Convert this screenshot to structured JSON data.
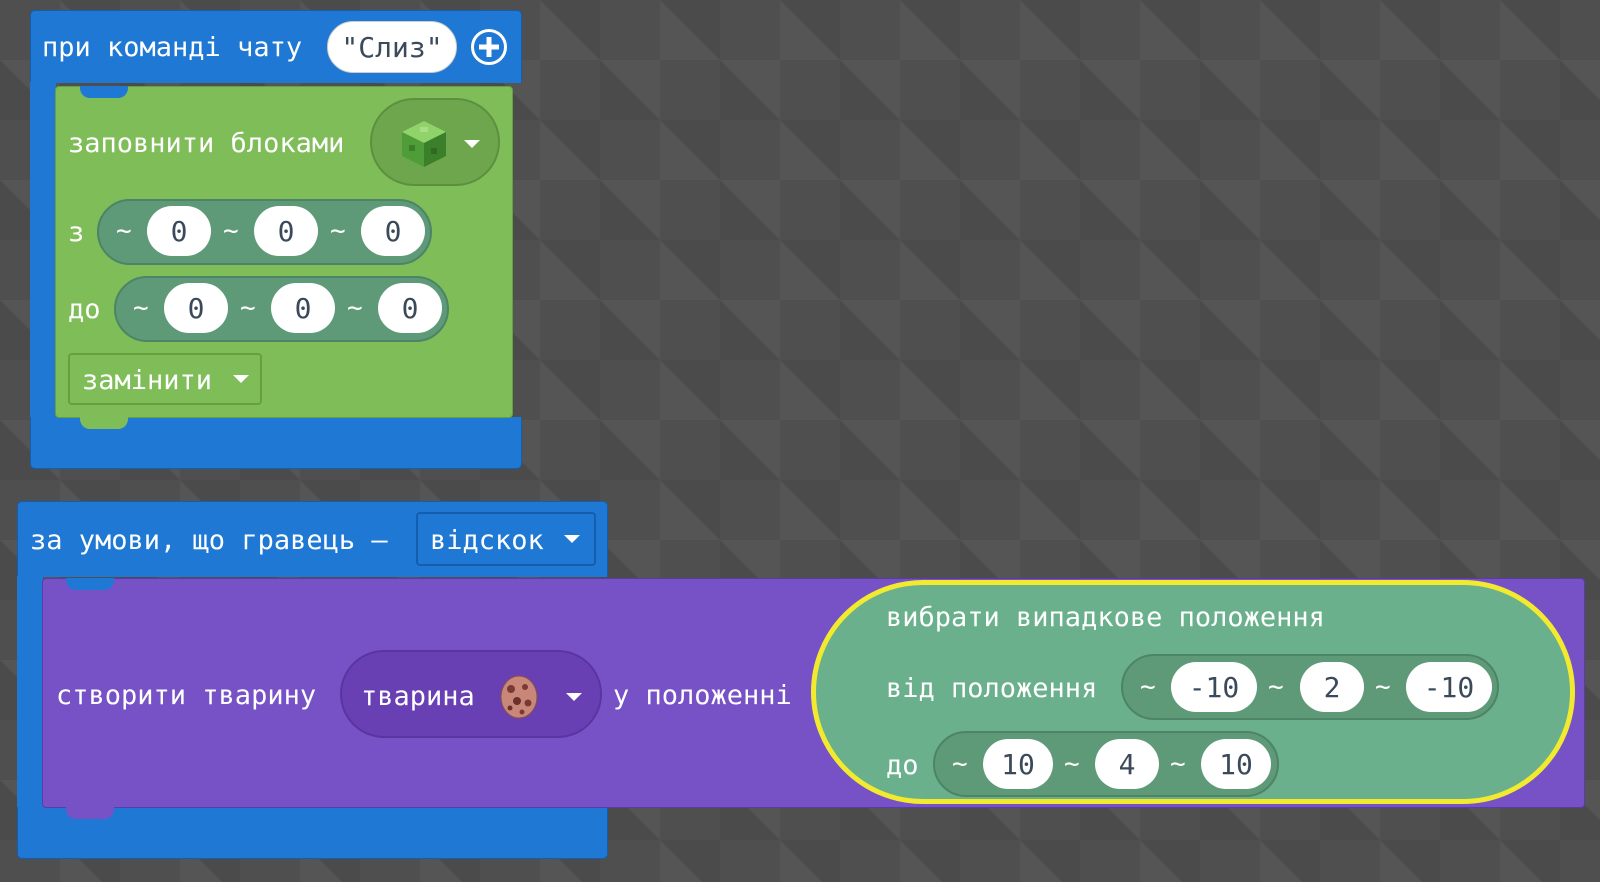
{
  "chat_block": {
    "label": "при команді чату",
    "command_value": "\"Слиз\"",
    "add_icon": "plus-circle-icon",
    "fill": {
      "label": "заповнити блоками",
      "block_icon": "slime-block-icon",
      "from_label": "з",
      "from": [
        "0",
        "0",
        "0"
      ],
      "to_label": "до",
      "to": [
        "0",
        "0",
        "0"
      ],
      "mode": "замінити"
    }
  },
  "condition_block": {
    "label": "за умови, що гравець —",
    "condition_value": "відскок",
    "spawn": {
      "label": "створити тварину",
      "animal_label": "тварина",
      "animal_icon": "spawn-egg-icon",
      "position_label": "у положенні",
      "random": {
        "title": "вибрати випадкове положення",
        "from_label": "від положення",
        "from": [
          "-10",
          "2",
          "-10"
        ],
        "to_label": "до",
        "to": [
          "10",
          "4",
          "10"
        ]
      }
    }
  },
  "colors": {
    "events": "#1e78d4",
    "blocks": "#7fbd58",
    "mobs": "#7752c6",
    "positions": "#6ab08c",
    "highlight": "#f2ea2e"
  }
}
